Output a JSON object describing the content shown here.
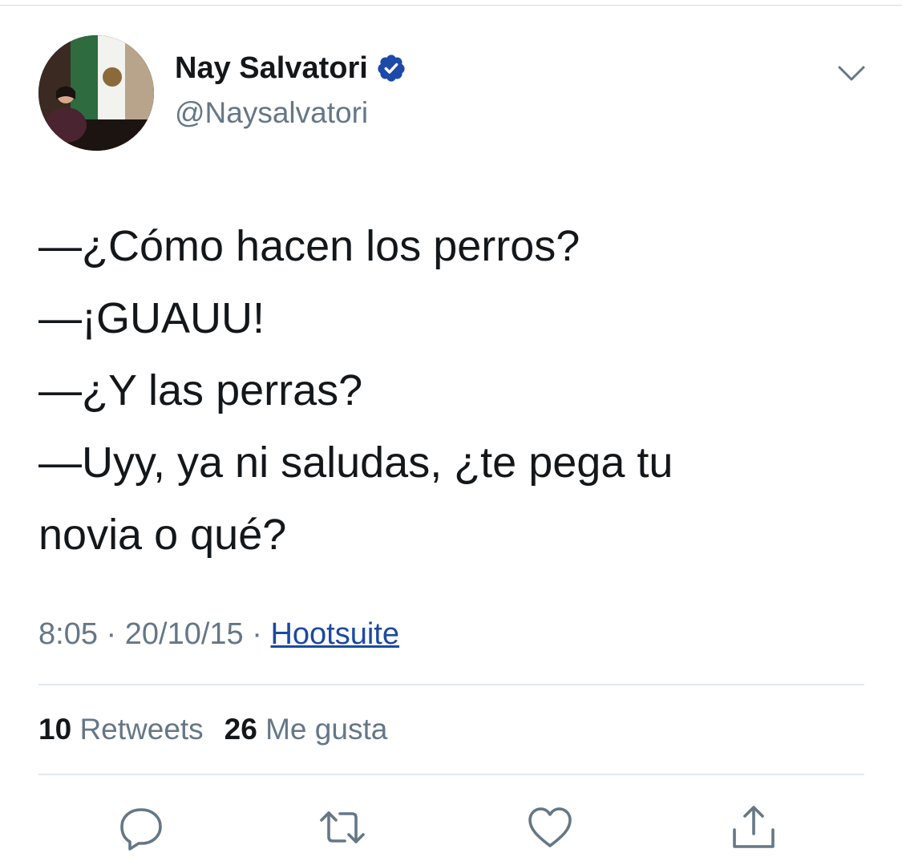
{
  "author": {
    "display_name": "Nay Salvatori",
    "handle": "@Naysalvatori",
    "verified": true,
    "verified_color": "#1d4aa8"
  },
  "tweet": {
    "lines": [
      "—¿Cómo hacen los perros?",
      "—¡GUAUU!",
      "—¿Y las perras?",
      "—Uyy, ya ni saludas, ¿te pega tu",
      "novia o qué?"
    ],
    "time": "8:05",
    "date": "20/10/15",
    "separator": "·",
    "source": "Hootsuite"
  },
  "stats": {
    "retweets_count": "10",
    "retweets_label": "Retweets",
    "likes_count": "26",
    "likes_label": "Me gusta"
  },
  "actions": [
    "reply-icon",
    "retweet-icon",
    "like-icon",
    "share-icon"
  ],
  "colors": {
    "text": "#14171a",
    "secondary": "#657786",
    "link": "#1b4aa0",
    "icon": "#657786",
    "divider": "#e1e8ed"
  }
}
